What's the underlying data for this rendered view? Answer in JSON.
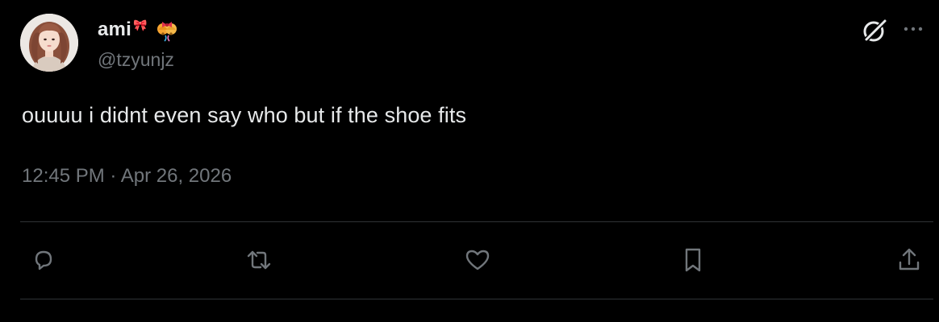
{
  "user": {
    "display_name": "ami",
    "name_decoration": "🎀",
    "handle": "@tzyunjz",
    "avatar_alt": "profile photo"
  },
  "tweet": {
    "text": "ouuuu i didnt even say who but if the shoe fits",
    "time": "12:45 PM",
    "separator": "·",
    "date": "Apr 26, 2026"
  },
  "header_actions": [
    {
      "icon": "grok-icon"
    },
    {
      "icon": "more-icon"
    }
  ],
  "actions": [
    {
      "icon": "reply-icon"
    },
    {
      "icon": "retweet-icon"
    },
    {
      "icon": "like-icon"
    },
    {
      "icon": "bookmark-icon"
    },
    {
      "icon": "share-icon"
    }
  ],
  "colors": {
    "background": "#000000",
    "text_primary": "#e7e9ea",
    "text_secondary": "#71767b",
    "divider": "#2f3336"
  }
}
